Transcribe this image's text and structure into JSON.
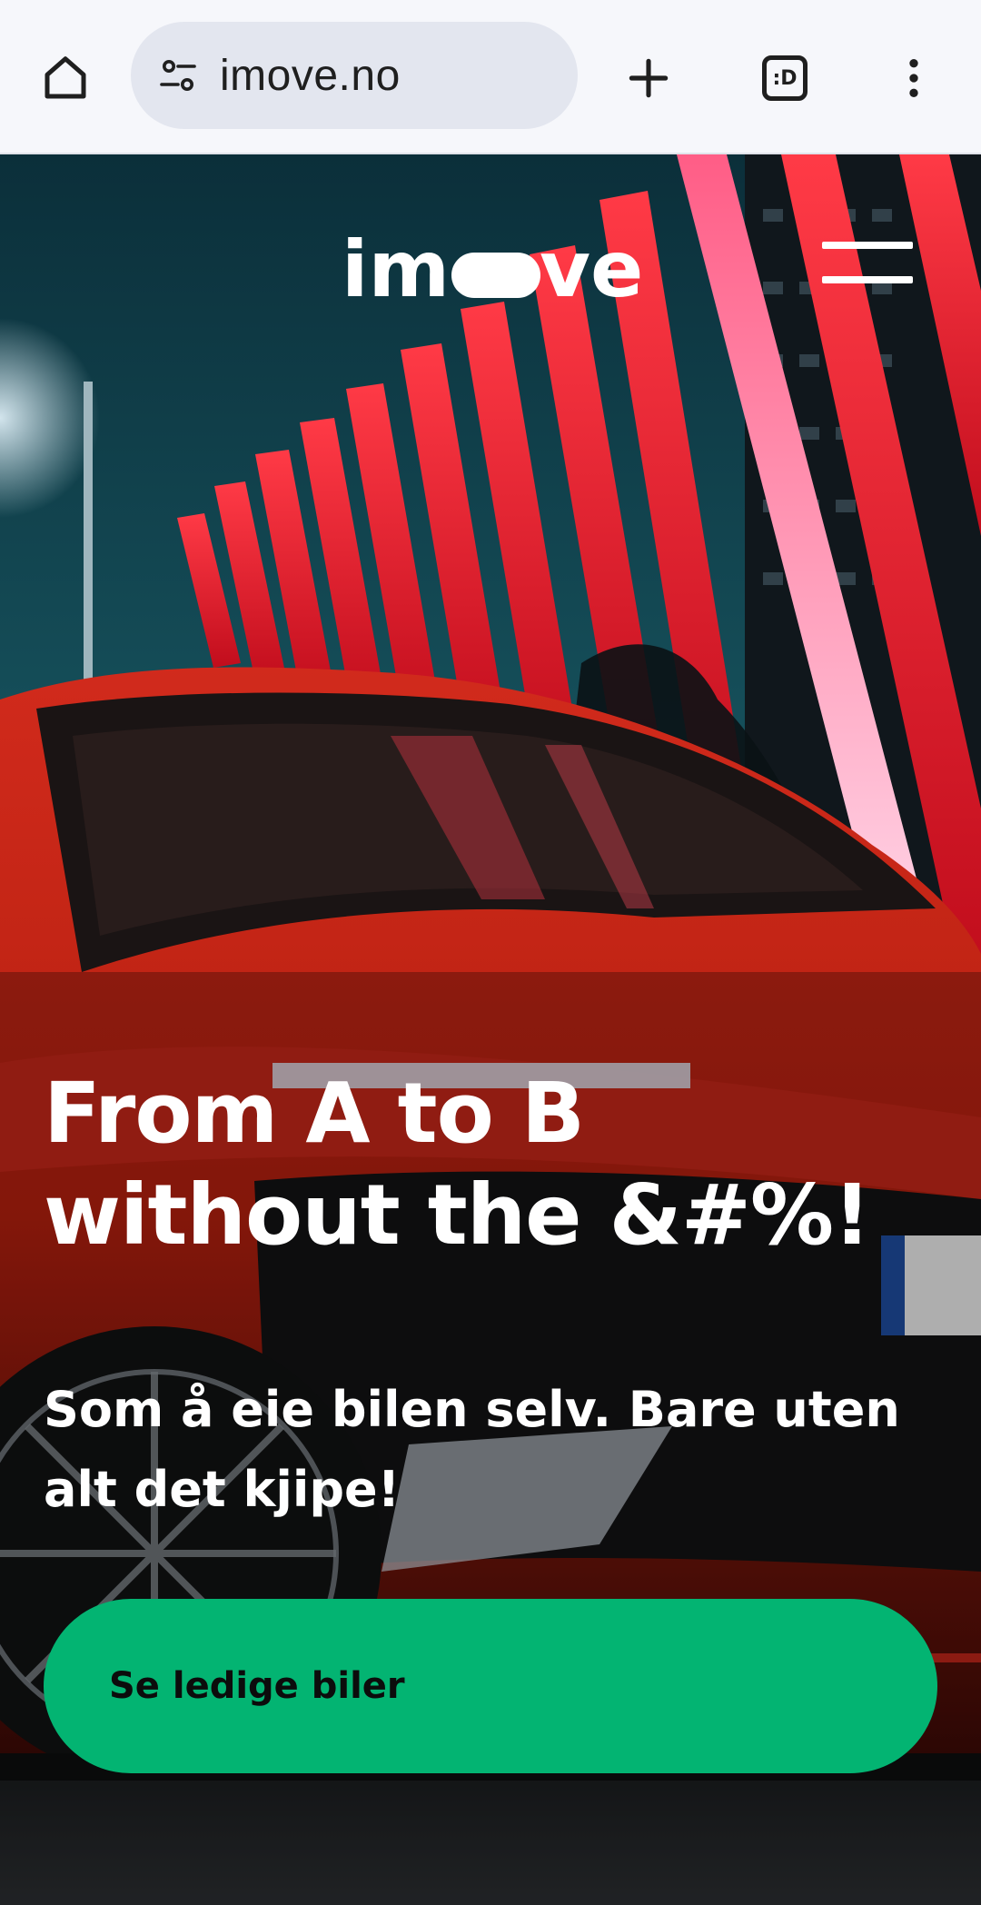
{
  "browser": {
    "url": "imove.no",
    "tab_count_label": ":D",
    "icons": {
      "home": "home-icon",
      "site_settings": "site-settings-icon",
      "new_tab": "plus-icon",
      "tabs": "tab-switcher-icon",
      "menu": "more-vert-icon"
    }
  },
  "header": {
    "logo_text": "imove",
    "menu_icon": "hamburger-menu-icon"
  },
  "hero": {
    "headline": "From A to B without the &#%!",
    "subline": "Som å eie bilen selv. Bare uten alt det kjipe!",
    "cta_label": "Se ledige biler",
    "cta_color": "#03b472",
    "background_description_colors": {
      "sky": "#0f3a44",
      "pillars": "#e8192c",
      "car": "#c0231c"
    }
  }
}
